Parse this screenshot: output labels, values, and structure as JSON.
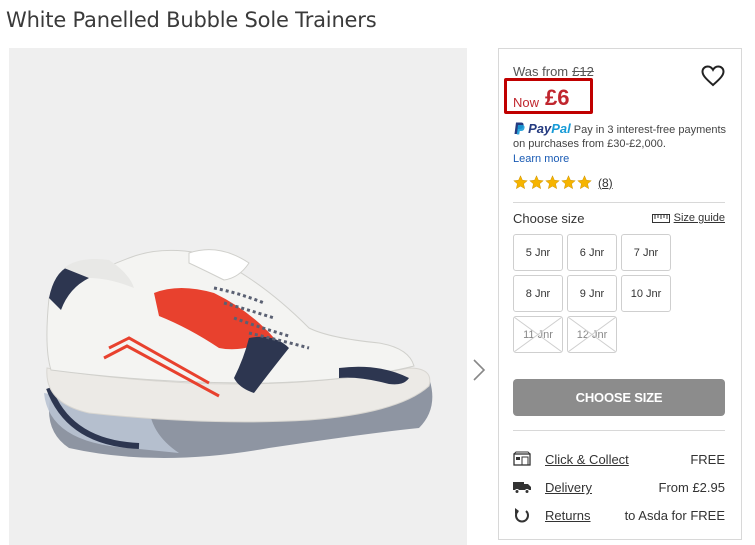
{
  "product": {
    "title": "White Panelled Bubble Sole Trainers"
  },
  "price": {
    "was_label": "Was from",
    "was_value": "£12",
    "now_label": "Now",
    "now_value": "£6"
  },
  "paypal": {
    "brand_pay": "Pay",
    "brand_pal": "Pal",
    "message": "Pay in 3 interest-free payments on purchases from £30-£2,000.",
    "learn_more": "Learn more"
  },
  "rating": {
    "stars": 5,
    "count": "(8)"
  },
  "size": {
    "heading": "Choose size",
    "guide_label": "Size guide",
    "options": [
      {
        "label": "5 Jnr",
        "available": true
      },
      {
        "label": "6 Jnr",
        "available": true
      },
      {
        "label": "7 Jnr",
        "available": true
      },
      {
        "label": "8 Jnr",
        "available": true
      },
      {
        "label": "9 Jnr",
        "available": true
      },
      {
        "label": "10 Jnr",
        "available": true
      },
      {
        "label": "11 Jnr",
        "available": false
      },
      {
        "label": "12 Jnr",
        "available": false
      }
    ],
    "button_label": "CHOOSE SIZE"
  },
  "delivery": [
    {
      "icon": "store-icon",
      "label": "Click & Collect",
      "value": "FREE"
    },
    {
      "icon": "truck-icon",
      "label": "Delivery",
      "value": "From £2.95"
    },
    {
      "icon": "return-icon",
      "label": "Returns",
      "value": "to Asda for FREE"
    }
  ],
  "colors": {
    "price_red": "#c0262e",
    "highlight_box": "#c00000",
    "star_yellow": "#f6b400",
    "button_grey": "#8c8c8c"
  }
}
